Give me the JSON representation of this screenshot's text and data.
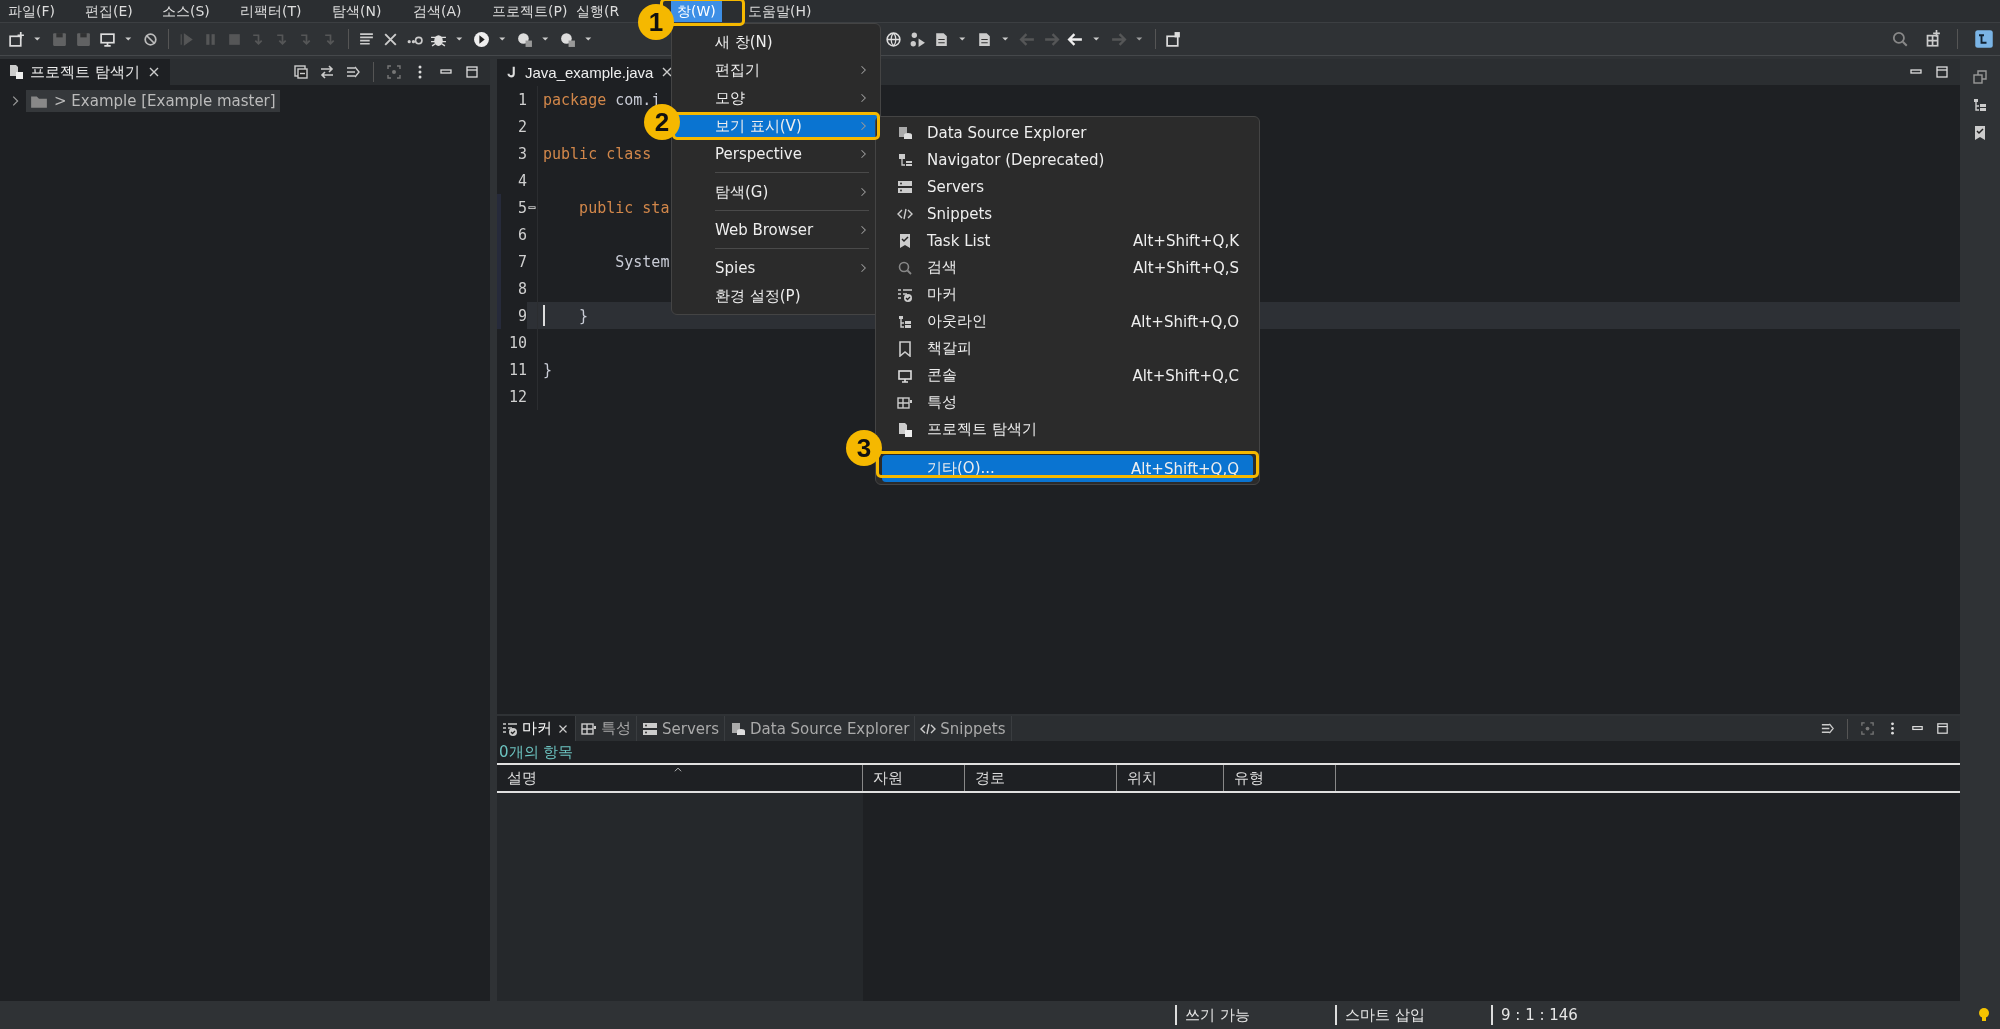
{
  "menu_bar": [
    {
      "label": "파일(F)",
      "selected": false
    },
    {
      "label": "편집(E)",
      "selected": false
    },
    {
      "label": "소스(S)",
      "selected": false
    },
    {
      "label": "리팩터(T)",
      "selected": false
    },
    {
      "label": "탐색(N)",
      "selected": false
    },
    {
      "label": "검색(A)",
      "selected": false
    },
    {
      "label": "프로젝트(P)",
      "selected": false
    },
    {
      "label": "실행(R",
      "selected": false
    },
    {
      "label": "창(W)",
      "selected": true
    },
    {
      "label": "도움말(H)",
      "selected": false
    }
  ],
  "project_explorer": {
    "title": "프로젝트 탐색기",
    "tree": [
      {
        "label": "> Example [Example master]",
        "expanded": false,
        "selected": true
      }
    ]
  },
  "editor": {
    "tab": "Java_example.java",
    "lines": [
      {
        "number": "1",
        "current": false,
        "tokens": [
          {
            "text": "package",
            "kind": "keyword"
          },
          {
            "text": " com.j",
            "kind": "plain"
          }
        ]
      },
      {
        "number": "2",
        "current": false
      },
      {
        "number": "3",
        "current": false,
        "tokens": [
          {
            "text": "public class",
            "kind": "keyword"
          }
        ]
      },
      {
        "number": "4",
        "current": false
      },
      {
        "number": "5",
        "current": false,
        "tokens": [
          {
            "text": "    public sta",
            "kind": "keyword"
          }
        ]
      },
      {
        "number": "6",
        "current": false
      },
      {
        "number": "7",
        "current": false,
        "tokens": [
          {
            "text": "        System",
            "kind": "plain"
          }
        ]
      },
      {
        "number": "8",
        "current": false
      },
      {
        "number": "9",
        "current": true,
        "tokens": [
          {
            "text": "    }",
            "kind": "plain"
          }
        ]
      },
      {
        "number": "10",
        "current": false
      },
      {
        "number": "11",
        "current": false,
        "tokens": [
          {
            "text": "}",
            "kind": "plain"
          }
        ]
      },
      {
        "number": "12",
        "current": false
      }
    ]
  },
  "window_menu": {
    "items": [
      {
        "kind": "item",
        "label": "새 창(N)",
        "submenu": false,
        "selected": false
      },
      {
        "kind": "item",
        "label": "편집기",
        "submenu": true,
        "selected": false
      },
      {
        "kind": "item",
        "label": "모양",
        "submenu": true,
        "selected": false
      },
      {
        "kind": "item",
        "label": "보기 표시(V)",
        "submenu": true,
        "selected": true
      },
      {
        "kind": "item",
        "label": "Perspective",
        "submenu": true,
        "selected": false
      },
      {
        "kind": "separator"
      },
      {
        "kind": "item",
        "label": "탐색(G)",
        "submenu": true,
        "selected": false
      },
      {
        "kind": "separator"
      },
      {
        "kind": "item",
        "label": "Web Browser",
        "submenu": true,
        "selected": false
      },
      {
        "kind": "separator"
      },
      {
        "kind": "item",
        "label": "Spies",
        "submenu": true,
        "selected": false
      },
      {
        "kind": "item",
        "label": "환경 설정(P)",
        "submenu": false,
        "selected": false
      }
    ]
  },
  "show_view_menu": {
    "items": [
      {
        "kind": "item",
        "label": "Data Source Explorer",
        "selected": false
      },
      {
        "kind": "item",
        "label": "Navigator (Deprecated)",
        "selected": false
      },
      {
        "kind": "item",
        "label": "Servers",
        "selected": false
      },
      {
        "kind": "item",
        "label": "Snippets",
        "selected": false
      },
      {
        "kind": "item",
        "label": "Task List",
        "shortcut": "Alt+Shift+Q,K",
        "selected": false
      },
      {
        "kind": "item",
        "label": "검색",
        "shortcut": "Alt+Shift+Q,S",
        "selected": false
      },
      {
        "kind": "item",
        "label": "마커",
        "selected": false
      },
      {
        "kind": "item",
        "label": "아웃라인",
        "shortcut": "Alt+Shift+Q,O",
        "selected": false
      },
      {
        "kind": "item",
        "label": "책갈피",
        "selected": false
      },
      {
        "kind": "item",
        "label": "콘솔",
        "shortcut": "Alt+Shift+Q,C",
        "selected": false
      },
      {
        "kind": "item",
        "label": "특성",
        "selected": false
      },
      {
        "kind": "item",
        "label": "프로젝트 탐색기",
        "selected": false
      },
      {
        "kind": "separator"
      },
      {
        "kind": "item",
        "label": "기타(O)...",
        "shortcut": "Alt+Shift+Q,Q",
        "selected": true
      }
    ]
  },
  "callouts": [
    {
      "number": "1"
    },
    {
      "number": "2"
    },
    {
      "number": "3"
    }
  ],
  "bottom_panel": {
    "tabs": [
      {
        "label": "마커",
        "selected": true
      },
      {
        "label": "특성",
        "selected": false
      },
      {
        "label": "Servers",
        "selected": false
      },
      {
        "label": "Data Source Explorer",
        "selected": false
      },
      {
        "label": "Snippets",
        "selected": false
      }
    ],
    "summary": "0개의 항목",
    "columns": [
      {
        "label": "설명",
        "sorted": true
      },
      {
        "label": "자원",
        "sorted": false
      },
      {
        "label": "경로",
        "sorted": false
      },
      {
        "label": "위치",
        "sorted": false
      },
      {
        "label": "유형",
        "sorted": false
      }
    ]
  },
  "status_bar": [
    "쓰기 가능",
    "스마트 삽입",
    "9 : 1 : 146"
  ]
}
